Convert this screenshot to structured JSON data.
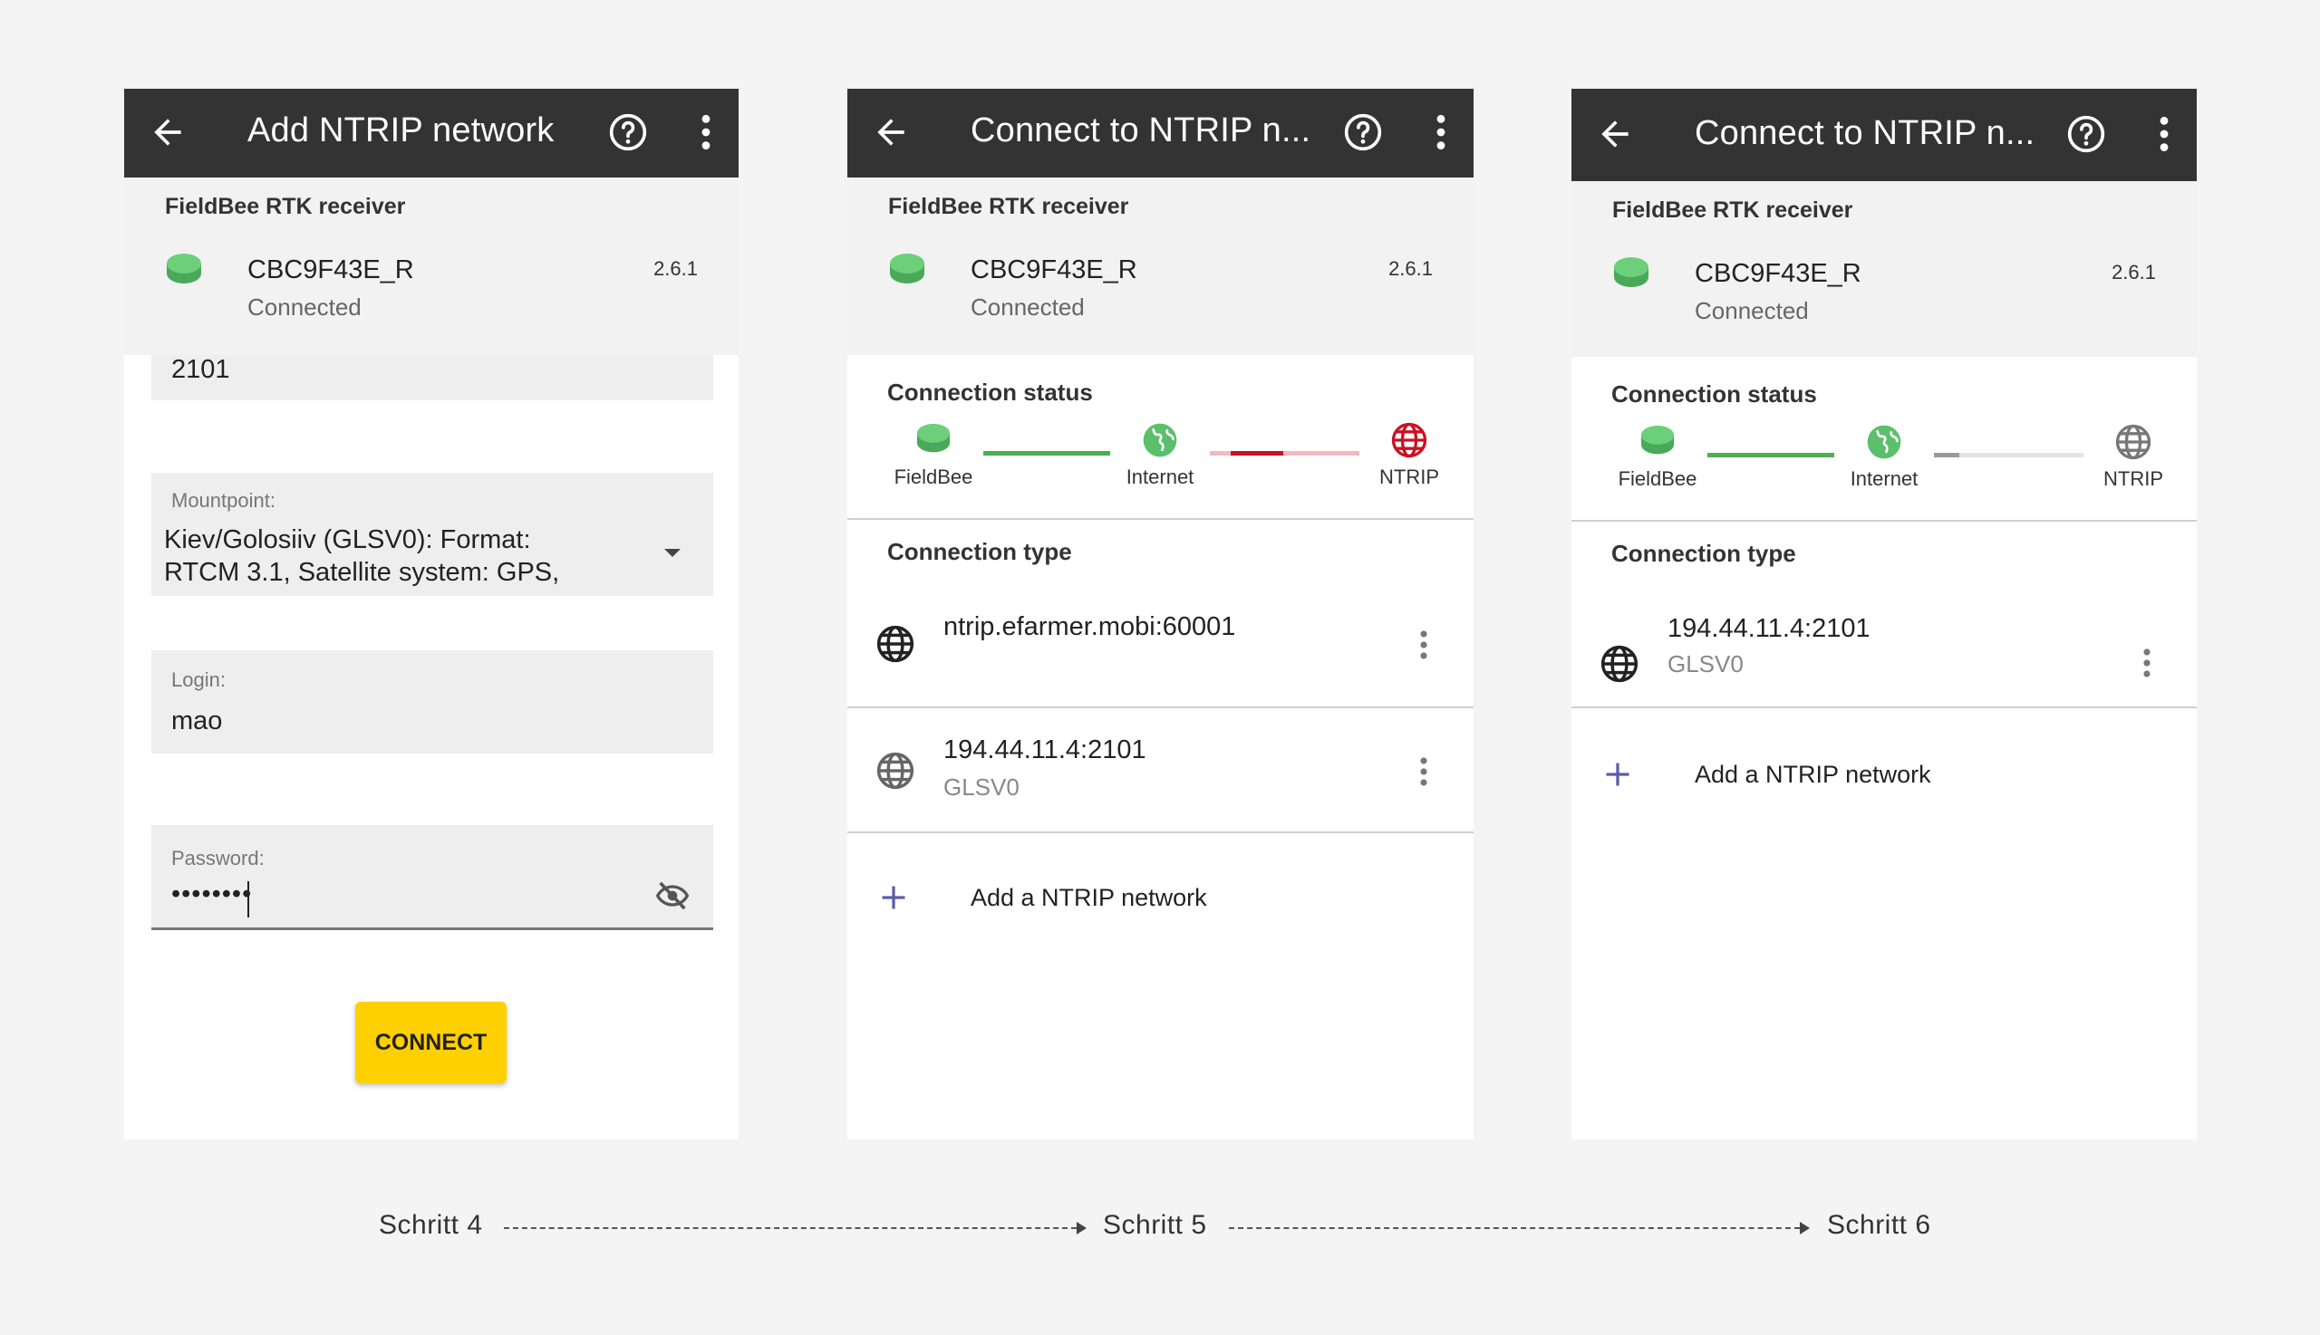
{
  "colors": {
    "appbar": "#333333",
    "receiver_green": "#5cbf6c",
    "line_green": "#4caf50",
    "line_red": "#cc1122",
    "line_pink": "#f4b8c0",
    "ntrip_red": "#cc1122",
    "ntrip_grey": "#777777",
    "connect_yellow": "#ffd000",
    "plus_purple": "#5c5ca8"
  },
  "screen4": {
    "title": "Add NTRIP network",
    "receiver": {
      "label": "FieldBee RTK receiver",
      "name": "CBC9F43E_R",
      "status": "Connected",
      "version": "2.6.1",
      "icon": "receiver-icon"
    },
    "port_value": "2101",
    "mountpoint": {
      "label": "Mountpoint:",
      "line1": "Kiev/Golosiiv (GLSV0): Format:",
      "line2": "RTCM 3.1, Satellite system: GPS,"
    },
    "login": {
      "label": "Login:",
      "value": "mao"
    },
    "password": {
      "label": "Password:",
      "value": "••••••••"
    },
    "connect_label": "CONNECT"
  },
  "screen5": {
    "title": "Connect to NTRIP n...",
    "receiver": {
      "label": "FieldBee RTK receiver",
      "name": "CBC9F43E_R",
      "status": "Connected",
      "version": "2.6.1"
    },
    "connection_status": {
      "label": "Connection status",
      "fieldbee": "FieldBee",
      "internet": "Internet",
      "ntrip": "NTRIP",
      "ntrip_state": "error"
    },
    "connection_type": {
      "label": "Connection type",
      "items": [
        {
          "name": "ntrip.efarmer.mobi:60001",
          "sub": "",
          "icon": "globe-icon"
        },
        {
          "name": "194.44.11.4:2101",
          "sub": "GLSV0",
          "icon": "globe-icon"
        }
      ],
      "add_label": "Add a NTRIP network"
    }
  },
  "screen6": {
    "title": "Connect to NTRIP n...",
    "receiver": {
      "label": "FieldBee RTK receiver",
      "name": "CBC9F43E_R",
      "status": "Connected",
      "version": "2.6.1"
    },
    "connection_status": {
      "label": "Connection status",
      "fieldbee": "FieldBee",
      "internet": "Internet",
      "ntrip": "NTRIP",
      "ntrip_state": "connecting"
    },
    "connection_type": {
      "label": "Connection type",
      "items": [
        {
          "name": "194.44.11.4:2101",
          "sub": "GLSV0",
          "icon": "globe-icon"
        }
      ],
      "add_label": "Add a NTRIP network"
    }
  },
  "steps": [
    "Schritt 4",
    "Schritt 5",
    "Schritt 6"
  ]
}
